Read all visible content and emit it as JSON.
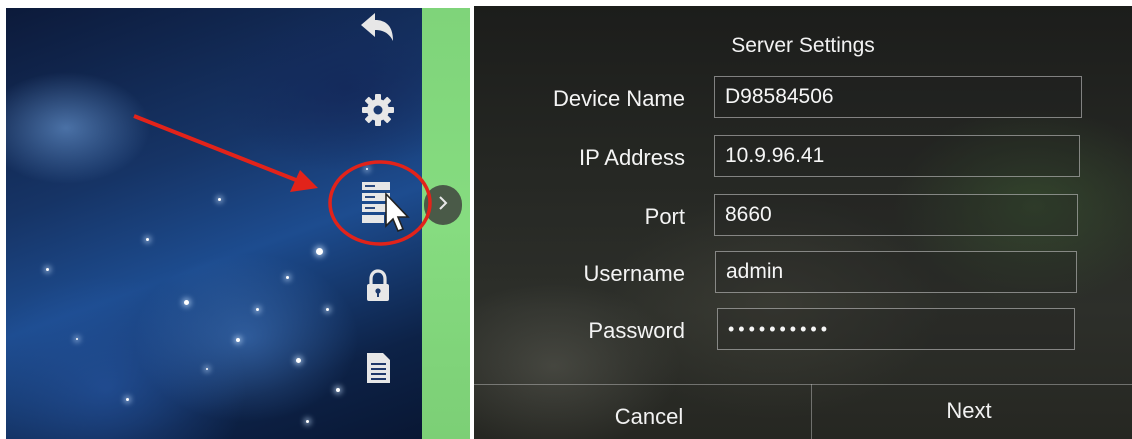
{
  "toolbar": {
    "icons": [
      "back-arrow-icon",
      "gear-icon",
      "server-settings-icon",
      "lock-icon",
      "document-icon"
    ],
    "expand_icon": "chevron-right-icon"
  },
  "annotation": {
    "color": "#e2231a"
  },
  "dialog": {
    "title": "Server Settings",
    "fields": [
      {
        "label": "Device Name",
        "value": "D98584506"
      },
      {
        "label": "IP Address",
        "value": "10.9.96.41"
      },
      {
        "label": "Port",
        "value": "8660"
      },
      {
        "label": "Username",
        "value": "admin"
      },
      {
        "label": "Password",
        "value": "••••••••••"
      }
    ],
    "cancel_label": "Cancel",
    "next_label": "Next"
  },
  "colors": {
    "green_strip": "#86dc80",
    "dialog_text": "#f4f4f4"
  }
}
